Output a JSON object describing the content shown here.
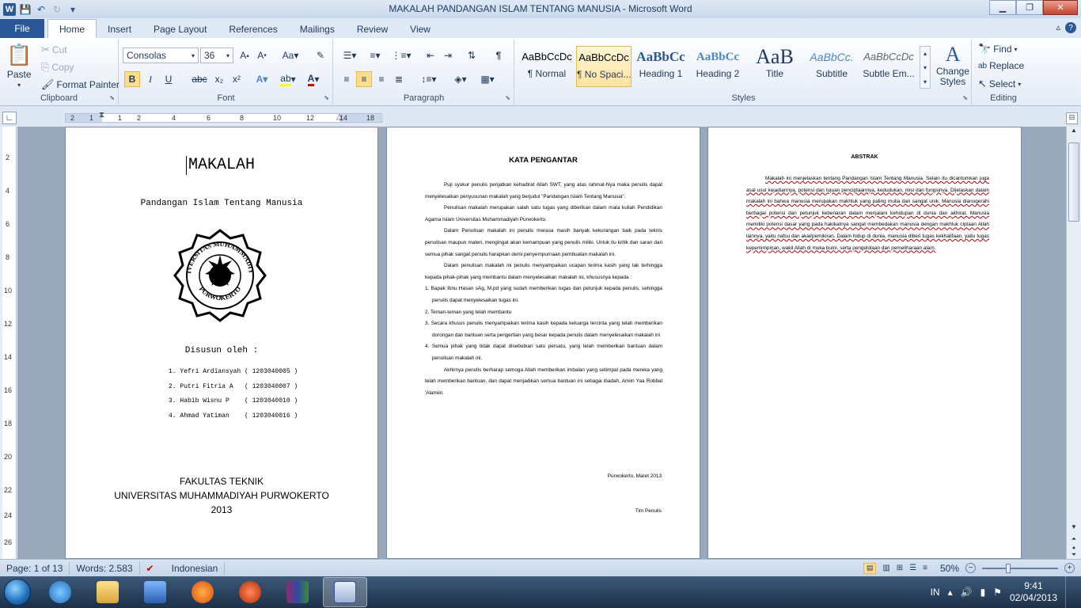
{
  "window": {
    "title": "MAKALAH PANDANGAN ISLAM TENTANG MANUSIA  -  Microsoft Word",
    "app_logo": "W"
  },
  "tabs": [
    "File",
    "Home",
    "Insert",
    "Page Layout",
    "References",
    "Mailings",
    "Review",
    "View"
  ],
  "ribbon": {
    "clipboard": {
      "label": "Clipboard",
      "paste": "Paste",
      "cut": "Cut",
      "copy": "Copy",
      "format_painter": "Format Painter"
    },
    "font": {
      "label": "Font",
      "font_name": "Consolas",
      "font_size": "36",
      "bold": "B",
      "italic": "I",
      "underline": "U",
      "strike": "abc",
      "subscript": "x₂",
      "superscript": "x²"
    },
    "paragraph": {
      "label": "Paragraph"
    },
    "styles": {
      "label": "Styles",
      "items": [
        {
          "preview": "AaBbCcDc",
          "name": "¶ Normal"
        },
        {
          "preview": "AaBbCcDc",
          "name": "¶ No Spaci..."
        },
        {
          "preview": "AaBbCc",
          "name": "Heading 1"
        },
        {
          "preview": "AaBbCc",
          "name": "Heading 2"
        },
        {
          "preview": "AaB",
          "name": "Title"
        },
        {
          "preview": "AaBbCc.",
          "name": "Subtitle"
        },
        {
          "preview": "AaBbCcDc",
          "name": "Subtle Em..."
        }
      ],
      "change_styles": "Change Styles"
    },
    "editing": {
      "label": "Editing",
      "find": "Find",
      "replace": "Replace",
      "select": "Select"
    }
  },
  "ruler": {
    "h_ticks": [
      "2",
      "1",
      "1",
      "2",
      "4",
      "6",
      "8",
      "10",
      "12",
      "14",
      "16",
      "18"
    ],
    "v_ticks": [
      "2",
      "4",
      "6",
      "8",
      "10",
      "12",
      "14",
      "16",
      "18",
      "20",
      "22",
      "24",
      "26"
    ]
  },
  "page1": {
    "title": "MAKALAH",
    "subtitle": "Pandangan Islam Tentang Manusia",
    "logo_text_top": "UNIVERSITAS MUHAMMADIYAH",
    "logo_text_bottom": "PURWOKERTO",
    "compiled_by": "Disusun oleh :",
    "authors": [
      "1. Yefri Ardiansyah ( 1203040005 )",
      "2. Putri Fitria A   ( 1203040007 )",
      "3. Habib Wisnu P    ( 1203040010 )",
      "4. Ahmad Yatiman    ( 1203040016 )"
    ],
    "faculty": "FAKULTAS TEKNIK",
    "university": "UNIVERSITAS MUHAMMADIYAH PURWOKERTO",
    "year": "2013"
  },
  "page2": {
    "heading": "KATA PENGANTAR",
    "paragraphs": [
      "Puji syukur penulis penjatkan kehadirat Allah SWT, yang atas rahmat-Nya maka penulis dapat menyelesaikan penyusunan makalah yang berjudul \"Pandangan Islam Tentang Manusia\".",
      "Penulisan makalah merupakan salah satu tugas yang diberikan dalam mata kuliah Pendidikan Agama Islam Universitas Muhammadiyah Purwokerto.",
      "Dalam Penulisan makalah ini penulis merasa masih banyak kekurangan baik pada teknis penulisan maupun materi, mengingat akan kemampuan yang penulis miliki. Untuk itu kritik dan saran dari semua pihak sangat penulis harapkan demi penyempurnaan pembuatan makalah ini.",
      "Dalam penulisan makalah ini penulis menyampaikan ucapan terima kasih yang tak terhingga kepada pihak-pihak yang membantu dalam menyelesaikan makalah ini, khususnya kepada :"
    ],
    "list": [
      "1. Bapak Ibnu Hasan sAg, M.pd yang sudah memberikan tugas dan petunjuk kepada penulis, sehingga penulis dapat menyelesaikan tugas ini.",
      "2. Teman-teman yang telah membantu",
      "3. Secara khusus penulis menyampaikan terima kasih kepada keluarga tercinta yang telah memberikan dorongan dan bantuan serta pengertian yang besar kepada penulis dalam menyelesaikan makalah ini",
      "4. Semua pihak yang tidak dapat disebutkan satu persatu, yang telah memberikan bantuan dalam penulisan makalah ini."
    ],
    "closing": "Akhirnya penulis berharap semoga Allah memberikan imbalan yang setimpal pada mereka yang telah memberikan bantuan, dan dapat menjadikan semua bantuan ini sebagai ibadah, Amiin Yaa Robbal 'Alamiin.",
    "place_date": "Purwokerto, Maret 2013",
    "signature": "Tim Penulis"
  },
  "page3": {
    "heading": "ABSTRAK",
    "body": "Makalah ini menjelaskan tentang Pandangan Islam Tentang Manusia. Selain itu dicantumkan juga asal usul kejadiannya, potensi dan tujuan penciptaannya, kedudukan, misi dan fungsinya. Dijelaskan dalam makalah ini bahwa manusia merupakan makhluk yang paling mulia dan sangat unik. Manusia dianugerahi berbagai potensi dan petunjuk kebenaran dalam menjalani kehidupan di dunia dan akhirat. Manusia memiliki potensi dasar yang pada hakikatnya sangat membedakan manusia dengan makhluk ciptaan Allah lainnya, yaitu nafsu dan akal/pemikiran. Dalam hidup di dunia, manusia diberi tugas kekhalifaan, yaitu tugas kepemimpinan, wakil Allah di muka bumi, serta pengelolaan dan pemeliharaan alam."
  },
  "status": {
    "page": "Page: 1 of 13",
    "words": "Words: 2.583",
    "language": "Indonesian",
    "zoom": "50%"
  },
  "taskbar": {
    "lang": "IN",
    "time": "9:41",
    "date": "02/04/2013"
  },
  "colors": {
    "accent": "#2b579a",
    "ribbon_bg": "#e3ebf6",
    "taskbar": "#1c3048"
  }
}
